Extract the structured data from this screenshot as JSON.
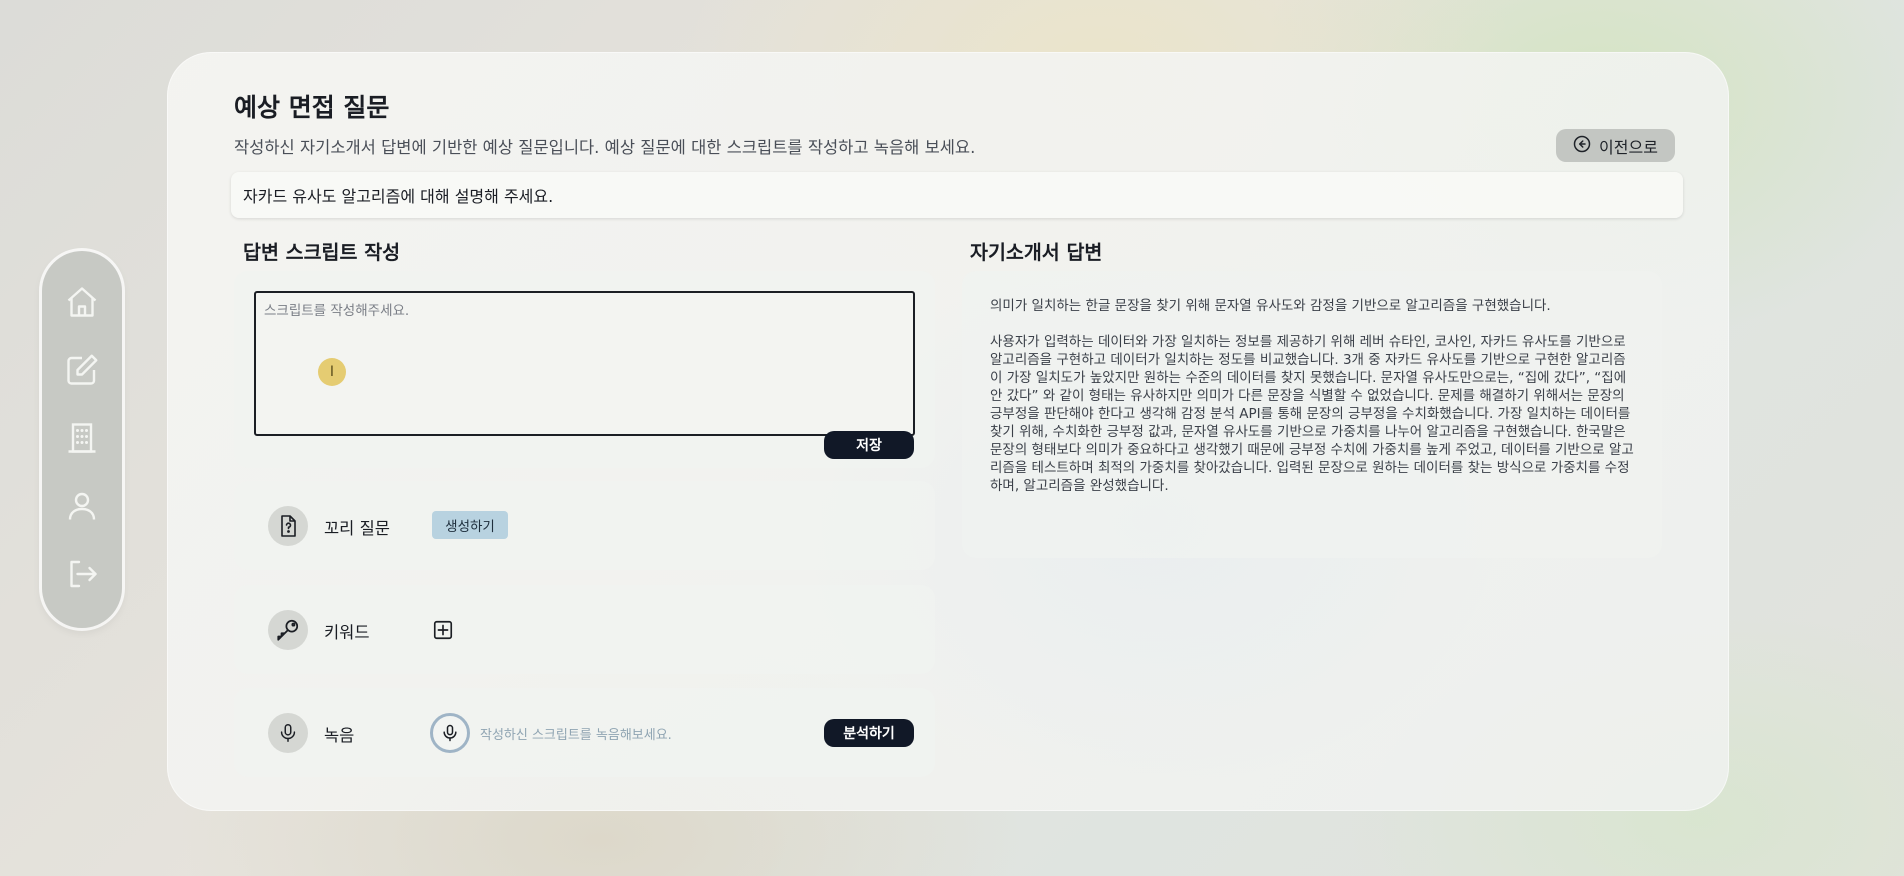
{
  "sidebar": {
    "items": [
      {
        "name": "home-icon"
      },
      {
        "name": "edit-icon"
      },
      {
        "name": "building-icon"
      },
      {
        "name": "user-icon"
      },
      {
        "name": "logout-icon"
      }
    ]
  },
  "header": {
    "title": "예상 면접 질문",
    "subtitle": "작성하신 자기소개서 답변에 기반한 예상 질문입니다. 예상 질문에 대한 스크립트를 작성하고 녹음해 보세요.",
    "back_label": "이전으로"
  },
  "question": "자카드 유사도 알고리즘에 대해 설명해 주세요.",
  "script": {
    "section_title": "답변 스크립트 작성",
    "placeholder": "스크립트를 작성해주세요.",
    "save_label": "저장"
  },
  "followup": {
    "label": "꼬리 질문",
    "generate_label": "생성하기"
  },
  "keyword": {
    "label": "키워드"
  },
  "recording": {
    "label": "녹음",
    "hint": "작성하신 스크립트를 녹음해보세요.",
    "analyze_label": "분석하기"
  },
  "cover_letter": {
    "section_title": "자기소개서 답변",
    "paragraph_1": "의미가 일치하는 한글 문장을 찾기 위해 문자열 유사도와 감정을 기반으로 알고리즘을 구현했습니다.",
    "paragraph_2": "사용자가 입력하는 데이터와 가장 일치하는 정보를 제공하기 위해 레버 슈타인, 코사인, 자카드 유사도를 기반으로 알고리즘을 구현하고 데이터가 일치하는 정도를 비교했습니다. 3개 중 자카드 유사도를 기반으로 구현한 알고리즘이 가장 일치도가 높았지만 원하는 수준의 데이터를 찾지 못했습니다. 문자열 유사도만으로는, “집에 갔다”, “집에 안 갔다” 와 같이 형태는 유사하지만 의미가 다른 문장을 식별할 수 없었습니다. 문제를 해결하기 위해서는 문장의 긍부정을 판단해야 한다고 생각해 감정 분석 API를 통해 문장의 긍부정을 수치화했습니다. 가장 일치하는 데이터를 찾기 위해, 수치화한 긍부정 값과, 문자열 유사도를 기반으로 가중치를 나누어 알고리즘을 구현했습니다. 한국말은 문장의 형태보다 의미가 중요하다고 생각했기 때문에 긍부정 수치에 가중치를 높게 주었고, 데이터를 기반으로 알고리즘을 테스트하며 최적의 가중치를 찾아갔습니다. 입력된 문장으로 원하는 데이터를 찾는 방식으로 가중치를 수정하며, 알고리즘을 완성했습니다."
  }
}
